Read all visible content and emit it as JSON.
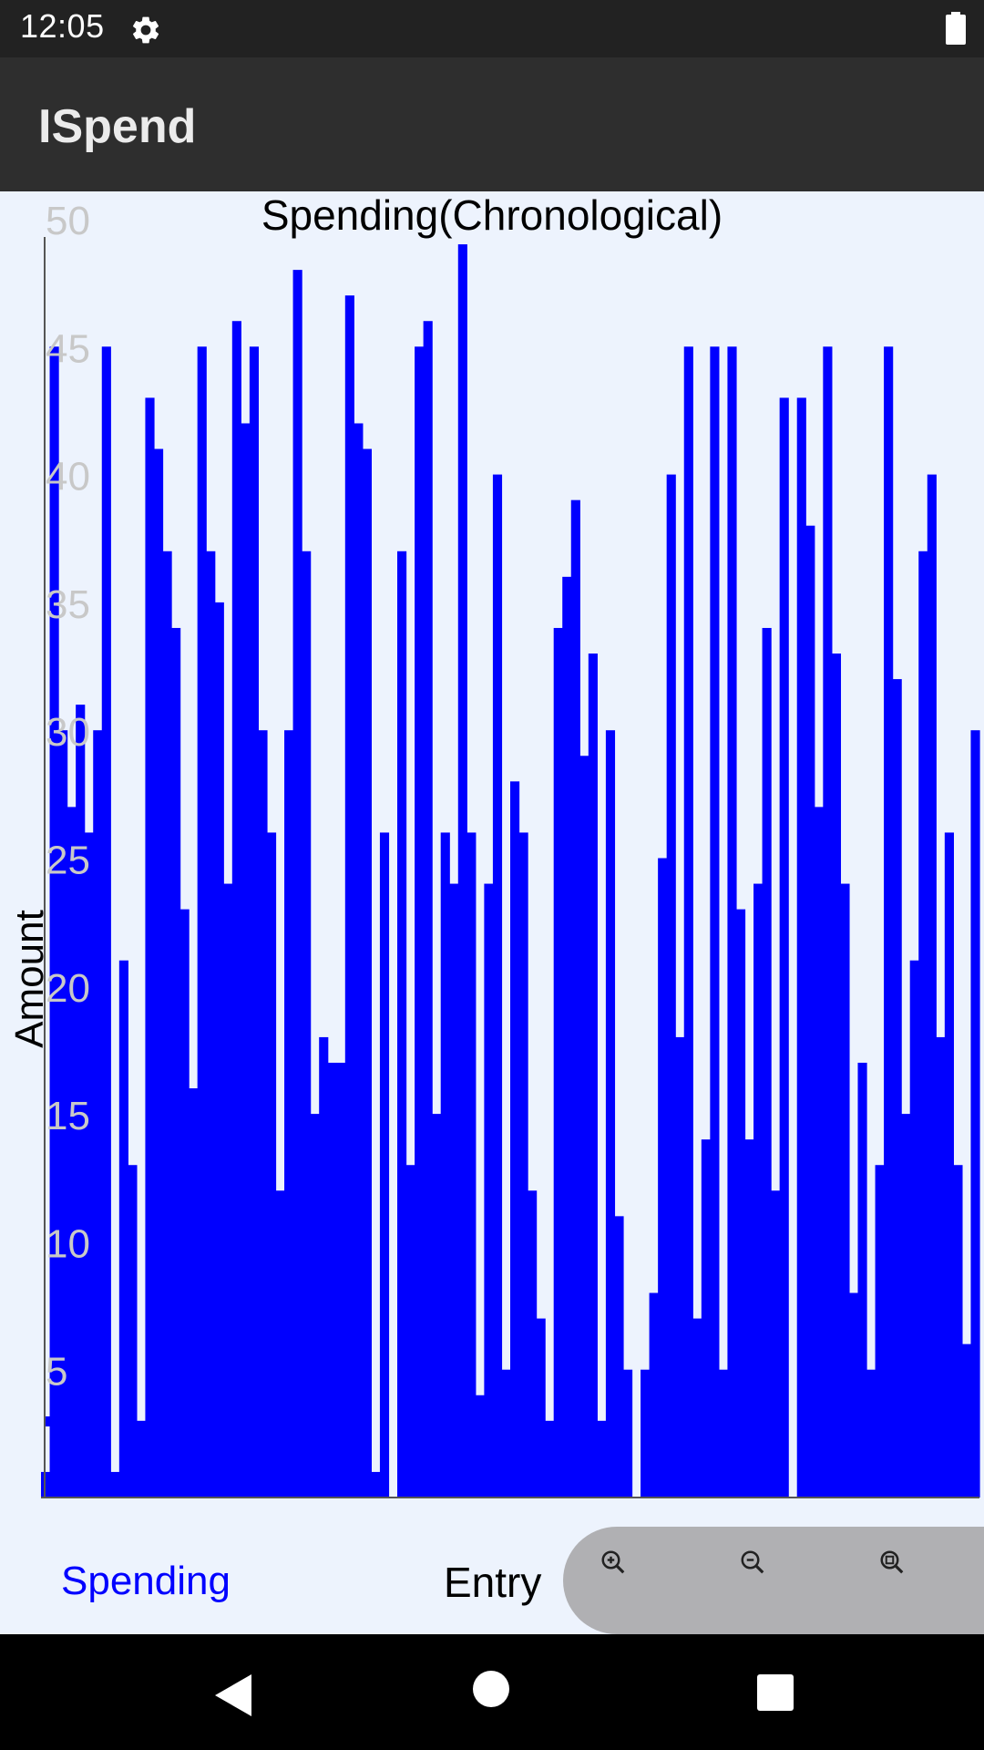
{
  "status_bar": {
    "time": "12:05",
    "icons": [
      "gear-icon",
      "battery-icon"
    ]
  },
  "app_bar": {
    "title": "ISpend"
  },
  "chart_data": {
    "type": "bar",
    "title": "Spending(Chronological)",
    "xlabel": "Entry",
    "ylabel": "Amount",
    "ylim": [
      0,
      50
    ],
    "yticks": [
      5,
      10,
      15,
      20,
      25,
      30,
      35,
      40,
      45,
      50
    ],
    "grid": false,
    "legend_position": "bottom-left",
    "series": [
      {
        "name": "Spending",
        "color": "#0000ff",
        "values": [
          1,
          45,
          30,
          27,
          31,
          26,
          30,
          45,
          1,
          21,
          13,
          3,
          43,
          41,
          37,
          34,
          23,
          16,
          45,
          37,
          35,
          24,
          46,
          42,
          45,
          30,
          26,
          12,
          30,
          48,
          37,
          15,
          18,
          17,
          17,
          47,
          42,
          41,
          1,
          26,
          0,
          37,
          13,
          45,
          46,
          15,
          26,
          24,
          49,
          26,
          4,
          24,
          40,
          5,
          28,
          26,
          12,
          7,
          3,
          34,
          36,
          39,
          29,
          33,
          3,
          30,
          11,
          5,
          0,
          5,
          8,
          25,
          40,
          18,
          45,
          7,
          14,
          45,
          5,
          45,
          23,
          14,
          24,
          34,
          12,
          43,
          0,
          43,
          38,
          27,
          45,
          33,
          24,
          8,
          17,
          5,
          13,
          45,
          32,
          15,
          21,
          37,
          40,
          18,
          26,
          13,
          6,
          30
        ]
      }
    ]
  },
  "zoom_controls": {
    "icons": [
      "zoom-in-icon",
      "zoom-out-icon",
      "zoom-reset-icon"
    ]
  },
  "nav_bar": {
    "icons": [
      "back-icon",
      "home-icon",
      "recents-icon"
    ]
  }
}
